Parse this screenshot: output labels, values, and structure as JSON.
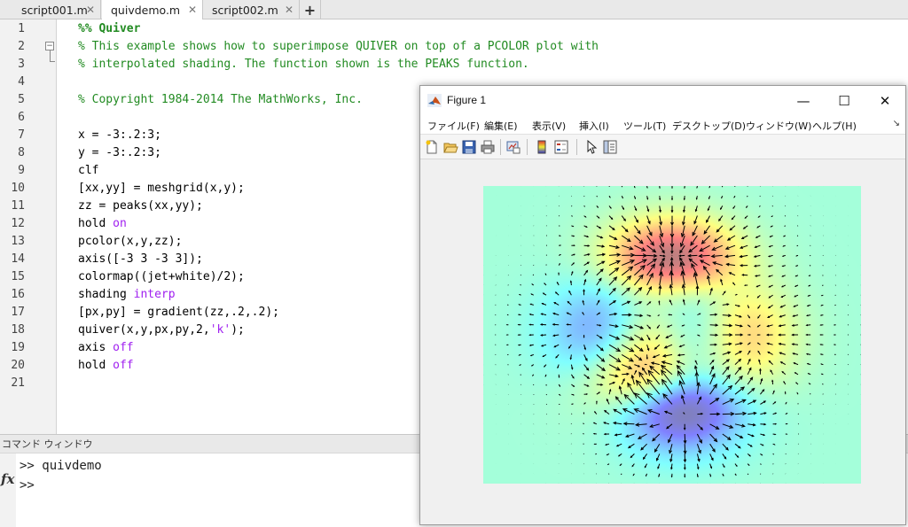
{
  "tabs": [
    {
      "label": "script001.m",
      "close": "✕"
    },
    {
      "label": "quivdemo.m",
      "close": "✕",
      "active": true
    },
    {
      "label": "script002.m",
      "close": "✕"
    }
  ],
  "add_tab_label": "+",
  "editor": {
    "lines": [
      {
        "num": "1",
        "parts": [
          [
            "cellh",
            "%% Quiver"
          ]
        ]
      },
      {
        "num": "2",
        "parts": [
          [
            "cmt",
            "% This example shows how to superimpose QUIVER on top of a PCOLOR plot with"
          ]
        ]
      },
      {
        "num": "3",
        "parts": [
          [
            "cmt",
            "% interpolated shading. The function shown is the PEAKS function."
          ]
        ]
      },
      {
        "num": "4",
        "parts": []
      },
      {
        "num": "5",
        "parts": [
          [
            "cmt",
            "% Copyright 1984-2014 The MathWorks, Inc."
          ]
        ]
      },
      {
        "num": "6",
        "parts": []
      },
      {
        "num": "7",
        "parts": [
          [
            "",
            "x = -3:.2:3;"
          ]
        ]
      },
      {
        "num": "8",
        "parts": [
          [
            "",
            "y = -3:.2:3;"
          ]
        ]
      },
      {
        "num": "9",
        "parts": [
          [
            "",
            "clf"
          ]
        ]
      },
      {
        "num": "10",
        "parts": [
          [
            "",
            "[xx,yy] = meshgrid(x,y);"
          ]
        ]
      },
      {
        "num": "11",
        "parts": [
          [
            "",
            "zz = peaks(xx,yy);"
          ]
        ]
      },
      {
        "num": "12",
        "parts": [
          [
            "",
            "hold "
          ],
          [
            "kw",
            "on"
          ]
        ]
      },
      {
        "num": "13",
        "parts": [
          [
            "",
            "pcolor(x,y,zz);"
          ]
        ]
      },
      {
        "num": "14",
        "parts": [
          [
            "",
            "axis([-3 3 -3 3]);"
          ]
        ]
      },
      {
        "num": "15",
        "parts": [
          [
            "",
            "colormap((jet+white)/2);"
          ]
        ]
      },
      {
        "num": "16",
        "parts": [
          [
            "",
            "shading "
          ],
          [
            "kw",
            "interp"
          ]
        ]
      },
      {
        "num": "17",
        "parts": [
          [
            "",
            "[px,py] = gradient(zz,.2,.2);"
          ]
        ]
      },
      {
        "num": "18",
        "parts": [
          [
            "",
            "quiver(x,y,px,py,2,"
          ],
          [
            "str",
            "'k'"
          ],
          [
            "",
            ");"
          ]
        ]
      },
      {
        "num": "19",
        "parts": [
          [
            "",
            "axis "
          ],
          [
            "kw",
            "off"
          ]
        ]
      },
      {
        "num": "20",
        "parts": [
          [
            "",
            "hold "
          ],
          [
            "kw",
            "off"
          ]
        ]
      },
      {
        "num": "21",
        "parts": []
      }
    ]
  },
  "command_window": {
    "title": "コマンド ウィンドウ",
    "lines": [
      ">> quivdemo",
      ">>"
    ],
    "fx": "fx"
  },
  "figure": {
    "title": "Figure 1",
    "controls": {
      "minimize": "—",
      "maximize": "☐",
      "close": "✕"
    },
    "menu": [
      "ファイル(F)",
      "編集(E)",
      "表示(V)",
      "挿入(I)",
      "ツール(T)",
      "デスクトップ(D)",
      "ウィンドウ(W)",
      "ヘルプ(H)"
    ],
    "menu_more": "↘",
    "toolbar": [
      "new-figure-icon",
      "open-file-icon",
      "save-icon",
      "print-icon",
      "link-plot-icon",
      "colorbar-icon",
      "legend-icon",
      "pointer-icon",
      "property-inspector-icon"
    ]
  },
  "chart_data": {
    "type": "quiver",
    "function": "peaks",
    "xlim": [
      -3,
      3
    ],
    "ylim": [
      -3,
      3
    ],
    "step": 0.2,
    "scale": 2,
    "colormap": "(jet+white)/2",
    "shading": "interp",
    "axis": "off",
    "arrow_color": "#000000"
  }
}
